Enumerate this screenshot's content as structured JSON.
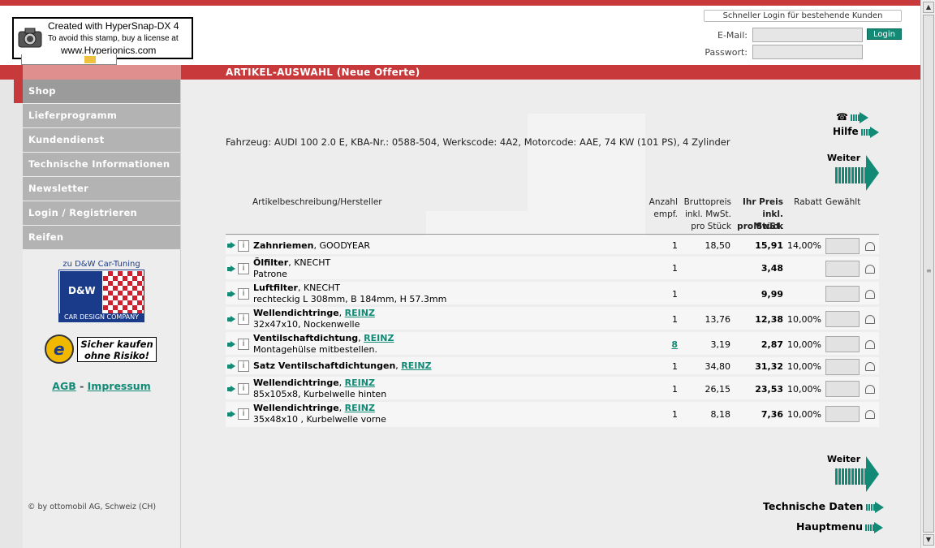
{
  "stamp": {
    "line1": "Created with HyperSnap-DX 4",
    "line2": "To avoid this stamp, buy a license at",
    "line3": "www.Hyperionics.com"
  },
  "login": {
    "quick_label": "Schneller Login für bestehende Kunden",
    "email_label": "E-Mail:",
    "password_label": "Passwort:",
    "email_value": "",
    "password_value": "",
    "button_label": "Login"
  },
  "page_title": "ARTIKEL-AUSWAHL (Neue Offerte)",
  "nav": [
    {
      "label": "Shop",
      "active": true
    },
    {
      "label": "Lieferprogramm"
    },
    {
      "label": "Kundendienst"
    },
    {
      "label": "Technische Informationen"
    },
    {
      "label": "Newsletter"
    },
    {
      "label": "Login / Registrieren"
    },
    {
      "label": "Reifen"
    }
  ],
  "sidebar": {
    "dw_caption": "zu D&W Car-Tuning",
    "dw_initials": "D&W",
    "dw_text": "CAR DESIGN COMPANY",
    "trusted_seal": "e",
    "trusted_text": "Sicher kaufen ohne Risiko!",
    "agb": "AGB",
    "separator": "-",
    "impressum": "Impressum",
    "copyright": "© by ottomobil AG, Schweiz (CH)"
  },
  "help": {
    "phone_glyph": "☎",
    "hilfe": "Hilfe"
  },
  "vehicle": "Fahrzeug: AUDI 100 2.0 E, KBA-Nr.: 0588-504, Werkscode: 4A2, Motorcode: AAE, 74 KW (101 PS), 4 Zylinder",
  "weiter": "Weiter",
  "table": {
    "headers": {
      "description": "Artikelbeschreibung/Hersteller",
      "anzahl": "Anzahl",
      "empf": "empf.",
      "brutto1": "Bruttopreis",
      "brutto2": "inkl. MwSt.",
      "brutto3": "pro Stück",
      "ihr1": "Ihr Preis",
      "ihr2": "inkl. MwSt.",
      "ihr3": "pro Stück",
      "rabatt": "Rabatt",
      "gewaehlt": "Gewählt"
    },
    "rows": [
      {
        "name": "Zahnriemen",
        "maker": "GOODYEAR",
        "detail": "",
        "qty": "1",
        "brutto": "18,50",
        "price": "15,91",
        "rabatt": "14,00%"
      },
      {
        "name": "Ölfilter",
        "maker": "KNECHT",
        "detail": "Patrone",
        "qty": "1",
        "brutto": "",
        "price": "3,48",
        "rabatt": ""
      },
      {
        "name": "Luftfilter",
        "maker": "KNECHT",
        "detail": "rechteckig L 308mm, B 184mm, H 57.3mm",
        "qty": "1",
        "brutto": "",
        "price": "9,99",
        "rabatt": ""
      },
      {
        "name": "Wellendichtringe",
        "maker": "REINZ",
        "detail": "32x47x10, Nockenwelle",
        "qty": "1",
        "brutto": "13,76",
        "price": "12,38",
        "rabatt": "10,00%"
      },
      {
        "name": "Ventilschaftdichtung",
        "maker": "REINZ",
        "detail": "Montagehülse mitbestellen.",
        "qty": "8",
        "brutto": "3,19",
        "price": "2,87",
        "rabatt": "10,00%"
      },
      {
        "name": "Satz Ventilschaftdichtungen",
        "maker": "REINZ",
        "detail": "",
        "qty": "1",
        "brutto": "34,80",
        "price": "31,32",
        "rabatt": "10,00%"
      },
      {
        "name": "Wellendichtringe",
        "maker": "REINZ",
        "detail": "85x105x8, Kurbelwelle hinten",
        "qty": "1",
        "brutto": "26,15",
        "price": "23,53",
        "rabatt": "10,00%"
      },
      {
        "name": "Wellendichtringe",
        "maker": "REINZ",
        "detail": "35x48x10 , Kurbelwelle vorne",
        "qty": "1",
        "brutto": "8,18",
        "price": "7,36",
        "rabatt": "10,00%"
      }
    ]
  },
  "footer_links": {
    "technische_daten": "Technische Daten",
    "hauptmenu": "Hauptmenu"
  },
  "colors": {
    "brand_red": "#c8393b",
    "accent_teal": "#138a76",
    "nav_gray": "#b3b3b3"
  }
}
